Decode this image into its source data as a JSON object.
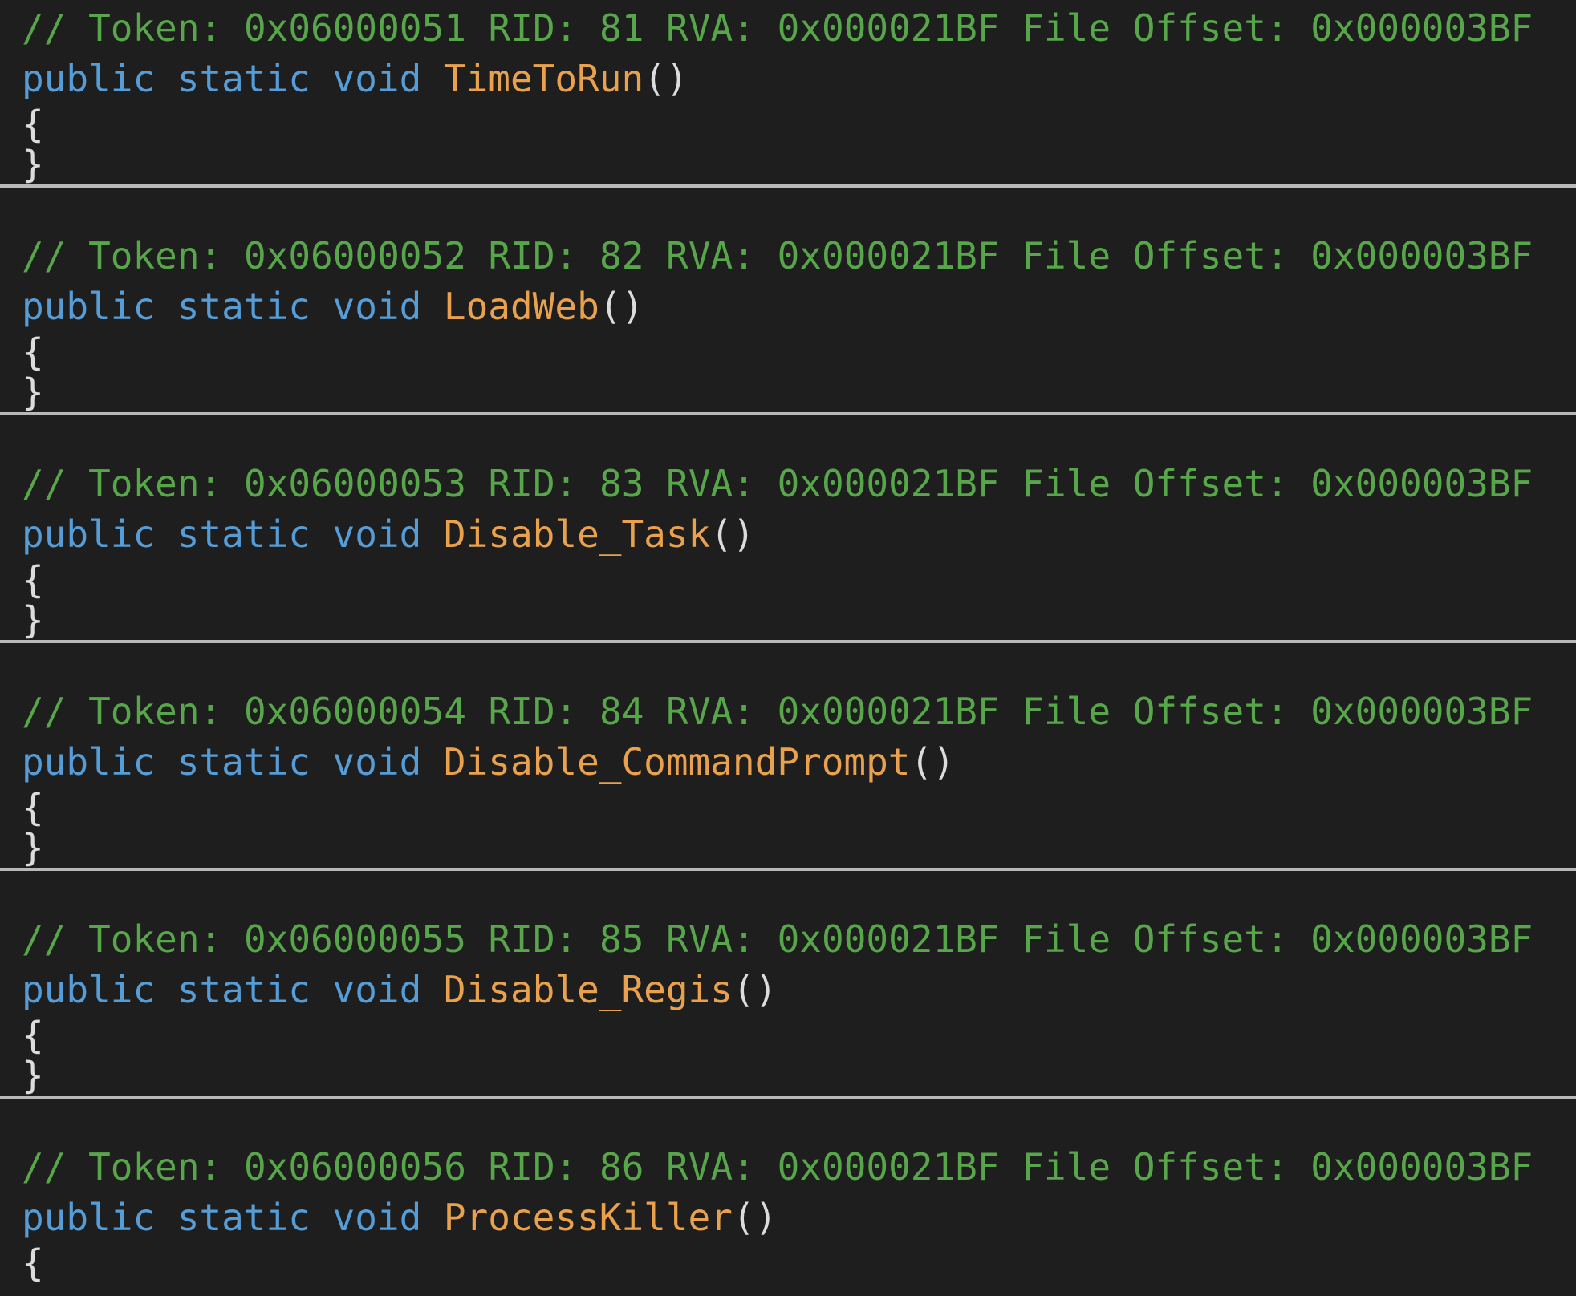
{
  "colors": {
    "background": "#1e1e1e",
    "comment": "#57a64a",
    "keyword": "#569cd6",
    "method_name": "#e9a14e",
    "punctuation": "#dcdcdc",
    "separator": "#b9b9b9"
  },
  "code": {
    "methods": [
      {
        "comment": "// Token: 0x06000051 RID: 81 RVA: 0x000021BF File Offset: 0x000003BF",
        "kw_public": "public",
        "kw_static": "static",
        "kw_void": "void",
        "name": "TimeToRun",
        "parens": "()",
        "open_brace": "{",
        "close_brace": "}"
      },
      {
        "comment": "// Token: 0x06000052 RID: 82 RVA: 0x000021BF File Offset: 0x000003BF",
        "kw_public": "public",
        "kw_static": "static",
        "kw_void": "void",
        "name": "LoadWeb",
        "parens": "()",
        "open_brace": "{",
        "close_brace": "}"
      },
      {
        "comment": "// Token: 0x06000053 RID: 83 RVA: 0x000021BF File Offset: 0x000003BF",
        "kw_public": "public",
        "kw_static": "static",
        "kw_void": "void",
        "name": "Disable_Task",
        "parens": "()",
        "open_brace": "{",
        "close_brace": "}"
      },
      {
        "comment": "// Token: 0x06000054 RID: 84 RVA: 0x000021BF File Offset: 0x000003BF",
        "kw_public": "public",
        "kw_static": "static",
        "kw_void": "void",
        "name": "Disable_CommandPrompt",
        "parens": "()",
        "open_brace": "{",
        "close_brace": "}"
      },
      {
        "comment": "// Token: 0x06000055 RID: 85 RVA: 0x000021BF File Offset: 0x000003BF",
        "kw_public": "public",
        "kw_static": "static",
        "kw_void": "void",
        "name": "Disable_Regis",
        "parens": "()",
        "open_brace": "{",
        "close_brace": "}"
      },
      {
        "comment": "// Token: 0x06000056 RID: 86 RVA: 0x000021BF File Offset: 0x000003BF",
        "kw_public": "public",
        "kw_static": "static",
        "kw_void": "void",
        "name": "ProcessKiller",
        "parens": "()",
        "open_brace": "{",
        "close_brace": ""
      }
    ]
  }
}
